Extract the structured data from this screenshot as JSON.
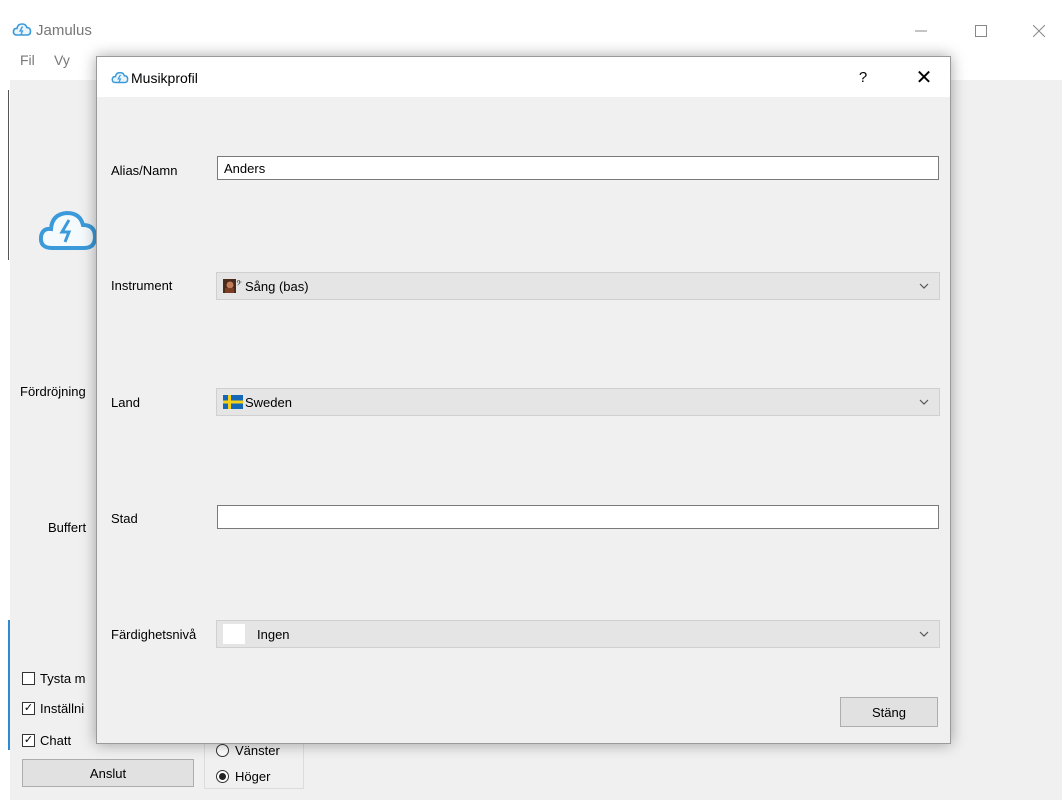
{
  "main_window": {
    "title": "Jamulus",
    "menu": [
      "Fil",
      "Vy"
    ],
    "labels": {
      "delay": "Fördröjning",
      "buffer": "Buffert"
    },
    "checkboxes": [
      {
        "label": "Tysta m",
        "checked": false
      },
      {
        "label": "Inställni",
        "checked": true
      },
      {
        "label": "Chatt",
        "checked": true
      }
    ],
    "connect_button": "Anslut",
    "radios": [
      {
        "label": "Vänster",
        "checked": false
      },
      {
        "label": "Höger",
        "checked": true
      }
    ]
  },
  "dialog": {
    "title": "Musikprofil",
    "help": "?",
    "close": "✕",
    "fields": {
      "alias": {
        "label": "Alias/Namn",
        "value": "Anders"
      },
      "instrument": {
        "label": "Instrument",
        "value": "Sång (bas)"
      },
      "country": {
        "label": "Land",
        "value": "Sweden"
      },
      "city": {
        "label": "Stad",
        "value": ""
      },
      "skill": {
        "label": "Färdighetsnivå",
        "value": "Ingen"
      }
    },
    "close_button": "Stäng"
  },
  "colors": {
    "accent": "#2f8ad1",
    "dialog_bg": "#f0f0f0",
    "combo_bg": "#e5e5e5"
  }
}
